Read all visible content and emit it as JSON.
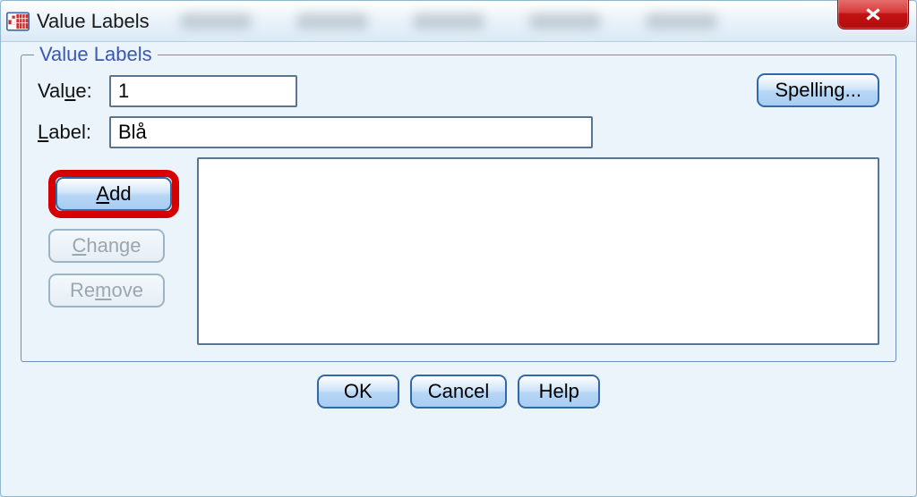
{
  "window": {
    "title": "Value Labels"
  },
  "group": {
    "legend": "Value Labels",
    "value_label": "Val",
    "value_mn": "u",
    "value_label_tail": "e:",
    "label_label_mn": "L",
    "label_label_tail": "abel:",
    "value_input": "1",
    "label_input": "Blå"
  },
  "buttons": {
    "spelling": "Spelling...",
    "add_mn": "A",
    "add_tail": "dd",
    "change_mn": "C",
    "change_tail": "hange",
    "remove_head": "Re",
    "remove_mn": "m",
    "remove_tail": "ove",
    "ok": "OK",
    "cancel": "Cancel",
    "help": "Help"
  }
}
